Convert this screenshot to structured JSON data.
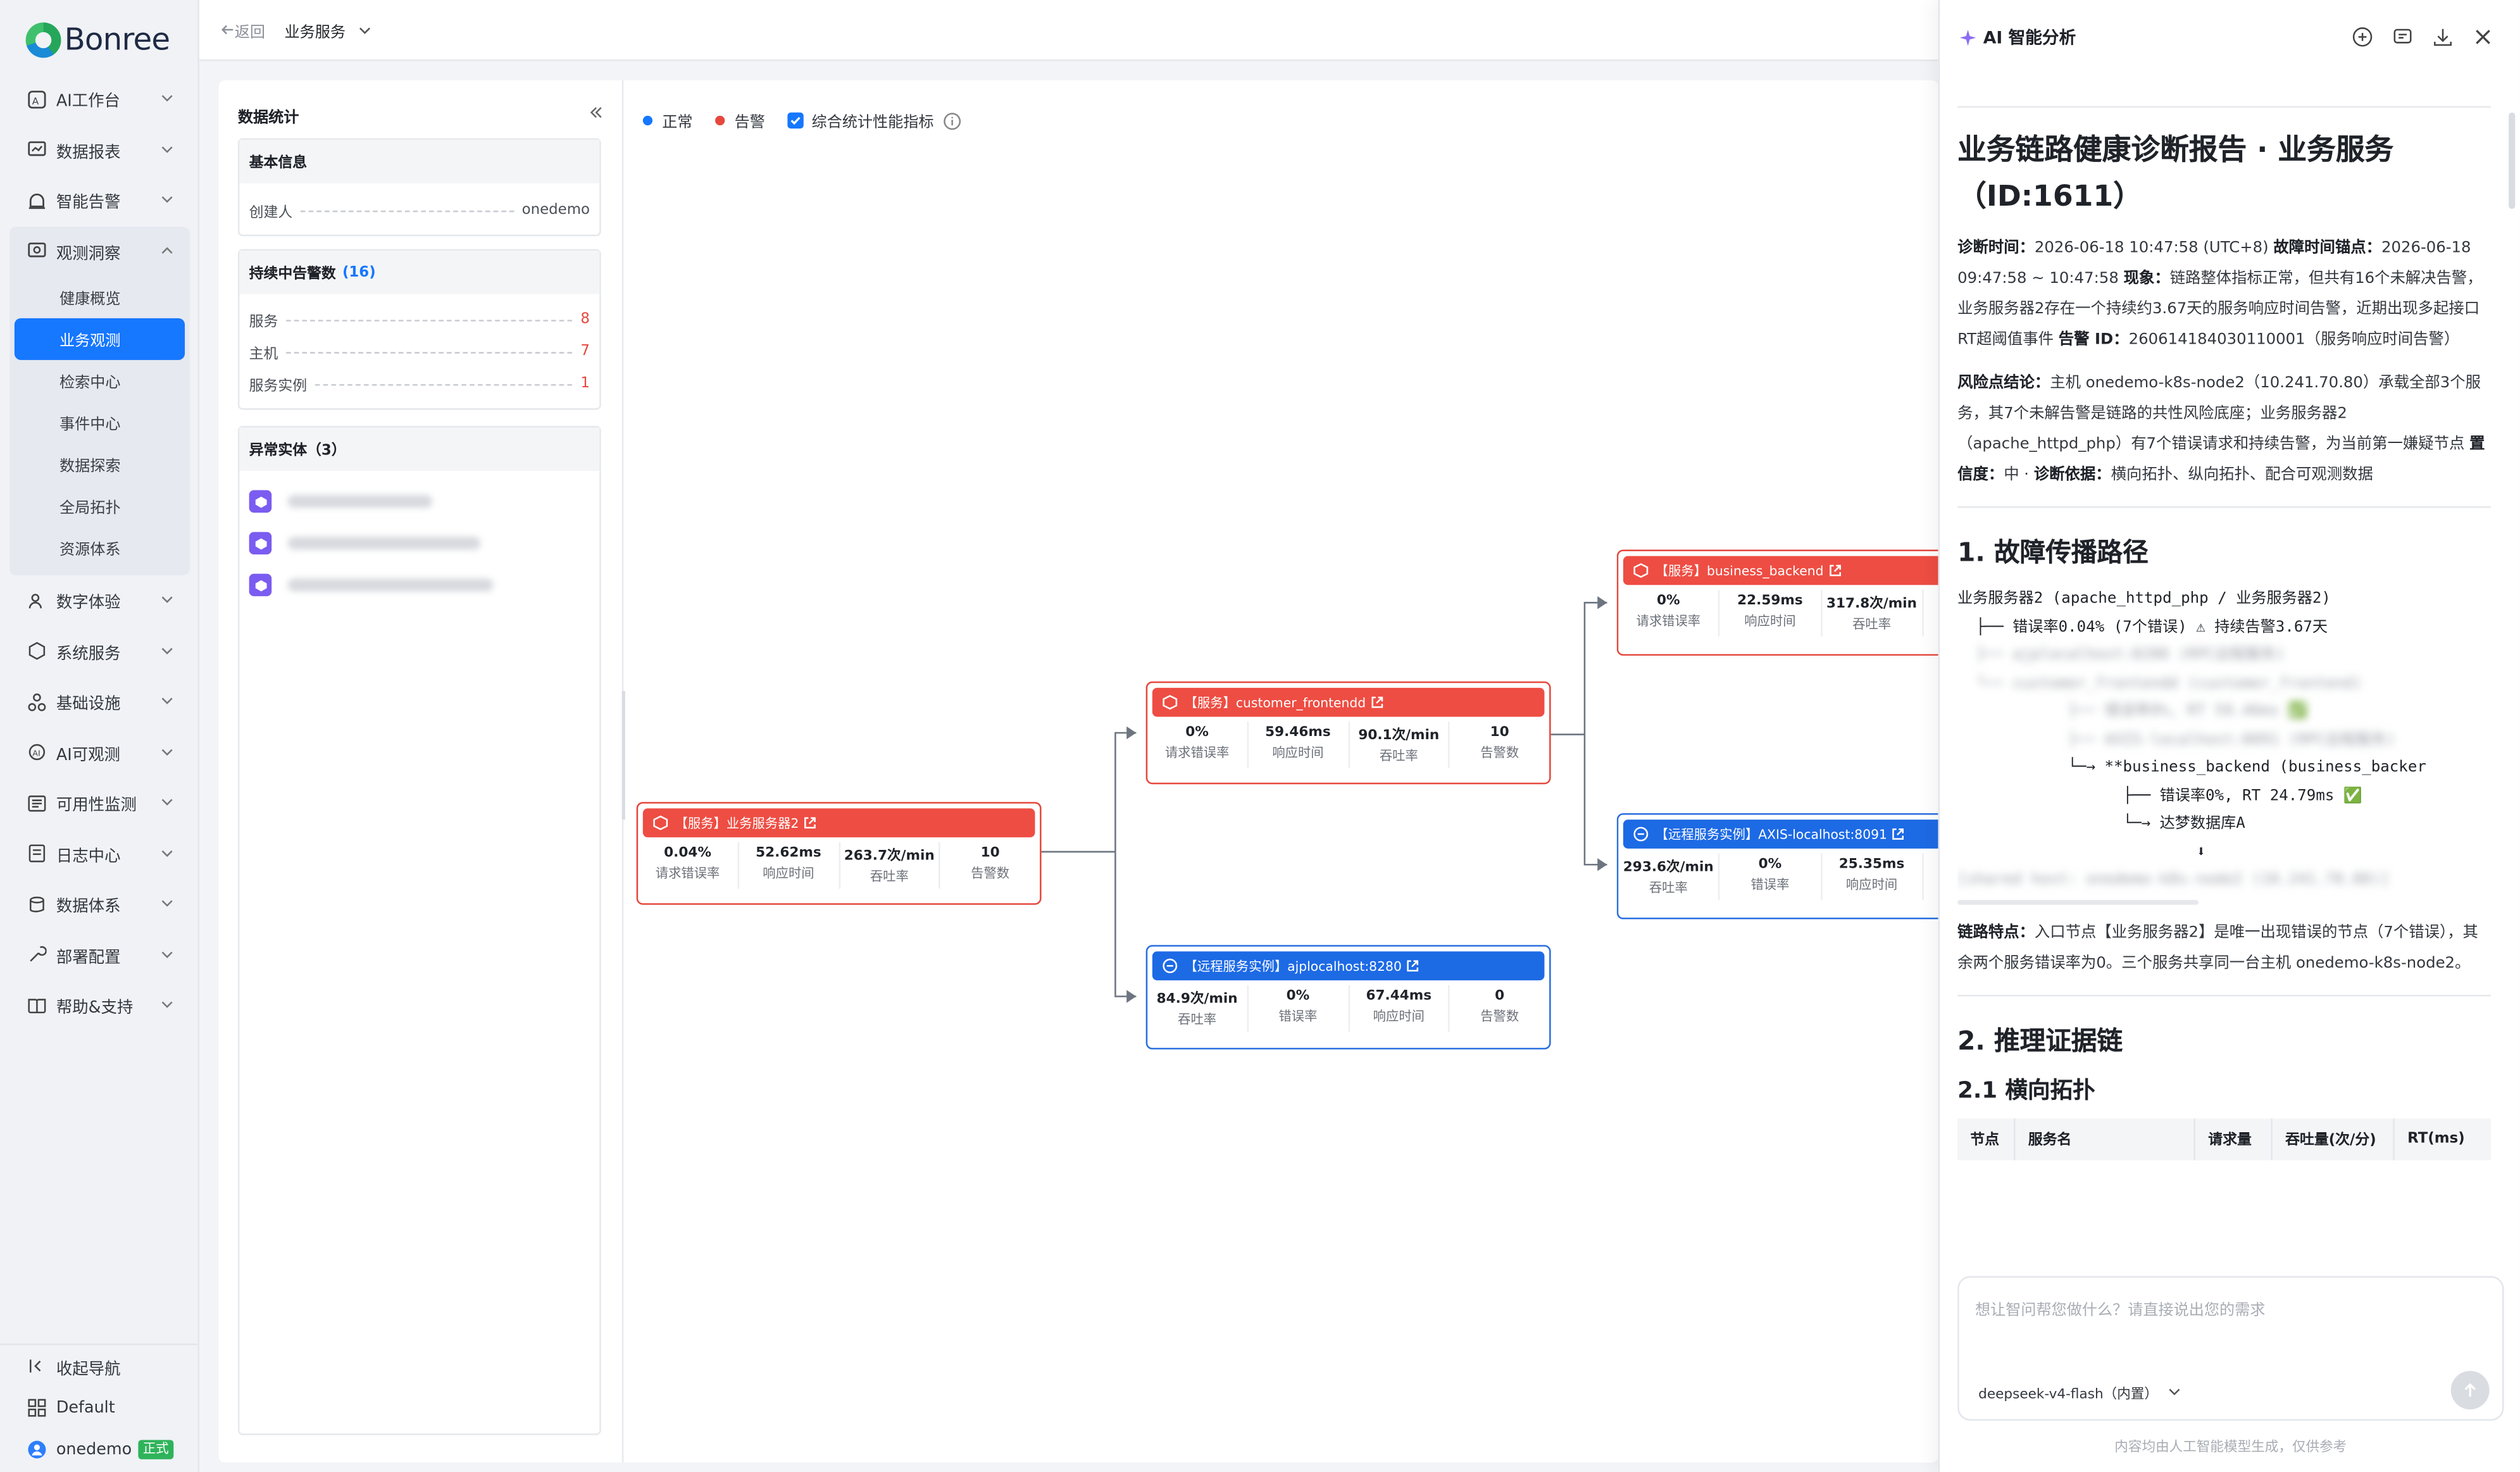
{
  "brand": "Bonree",
  "nav": [
    {
      "label": "AI工作台",
      "icon": "ai-workbench-icon"
    },
    {
      "label": "数据报表",
      "icon": "report-icon"
    },
    {
      "label": "智能告警",
      "icon": "alarm-icon"
    }
  ],
  "observe": {
    "label": "观测洞察",
    "subs": [
      "健康概览",
      "业务观测",
      "检索中心",
      "事件中心",
      "数据探索",
      "全局拓扑",
      "资源体系"
    ],
    "active": 1
  },
  "nav2": [
    {
      "label": "数字体验"
    },
    {
      "label": "系统服务"
    },
    {
      "label": "基础设施"
    },
    {
      "label": "AI可观测"
    },
    {
      "label": "可用性监测"
    },
    {
      "label": "日志中心"
    },
    {
      "label": "数据体系"
    },
    {
      "label": "部署配置"
    },
    {
      "label": "帮助&支持"
    }
  ],
  "footer": {
    "collapse": "收起导航",
    "space": "Default",
    "user": "onedemo",
    "user_tag": "正式"
  },
  "topbar": {
    "back": "返回",
    "title": "业务服务"
  },
  "stats": {
    "title": "数据统计",
    "basic": {
      "title": "基本信息",
      "creator_label": "创建人",
      "creator": "onedemo"
    },
    "alerts": {
      "title": "持续中告警数",
      "count": "(16)",
      "rows": [
        {
          "label": "服务",
          "value": "8"
        },
        {
          "label": "主机",
          "value": "7"
        },
        {
          "label": "服务实例",
          "value": "1"
        }
      ]
    },
    "abnormal": {
      "title": "异常实体（3）"
    }
  },
  "legend": {
    "normal": "正常",
    "alert": "告警",
    "combine": "综合统计性能指标",
    "normal_color": "#1677ff",
    "alert_color": "#e5483d"
  },
  "nodes": {
    "n1": {
      "title": "【服务】业务服务器2",
      "m": [
        [
          "0.04%",
          "请求错误率"
        ],
        [
          "52.62ms",
          "响应时间"
        ],
        [
          "263.7次/min",
          "吞吐率"
        ],
        [
          "10",
          "告警数"
        ]
      ]
    },
    "n2": {
      "title": "【服务】customer_frontendd",
      "m": [
        [
          "0%",
          "请求错误率"
        ],
        [
          "59.46ms",
          "响应时间"
        ],
        [
          "90.1次/min",
          "吞吐率"
        ],
        [
          "10",
          "告警数"
        ]
      ]
    },
    "n3": {
      "title": "【远程服务实例】ajplocalhost:8280",
      "m": [
        [
          "84.9次/min",
          "吞吐率"
        ],
        [
          "0%",
          "错误率"
        ],
        [
          "67.44ms",
          "响应时间"
        ],
        [
          "0",
          "告警数"
        ]
      ]
    },
    "n4": {
      "title": "【服务】business_backend",
      "m": [
        [
          "0%",
          "请求错误率"
        ],
        [
          "22.59ms",
          "响应时间"
        ],
        [
          "317.8次/min",
          "吞吐率"
        ]
      ]
    },
    "n5": {
      "title": "【远程服务实例】AXIS-localhost:8091",
      "m": [
        [
          "293.6次/min",
          "吞吐率"
        ],
        [
          "0%",
          "错误率"
        ],
        [
          "25.35ms",
          "响应时间"
        ]
      ]
    }
  },
  "ai": {
    "title": "AI 智能分析",
    "report_title": "业务链路健康诊断报告 · 业务服务（ID:1611）",
    "p1": {
      "l1": "诊断时间：",
      "v1": "2026-06-18 10:47:58 (UTC+8) ",
      "l2": "故障时间锚点：",
      "v2": "2026-06-18 09:47:58 ~ 10:47:58 ",
      "l3": "现象：",
      "v3": "链路整体指标正常，但共有16个未解决告警，业务服务器2存在一个持续约3.67天的服务响应时间告警，近期出现多起接口RT超阈值事件 ",
      "l4": "告警 ID：",
      "v4": "260614184030110001（服务响应时间告警）"
    },
    "p2": {
      "l1": "风险点结论：",
      "v1": "主机 onedemo-k8s-node2（10.241.70.80）承载全部3个服务，其7个未解告警是链路的共性风险底座；业务服务器2（apache_httpd_php）有7个错误请求和持续告警，为当前第一嫌疑节点 ",
      "l2": "置信度：",
      "v2": "中 · ",
      "l3": "诊断依据：",
      "v3": "横向拓扑、纵向拓扑、配合可观测数据"
    },
    "h_path": "1. 故障传播路径",
    "code": [
      "业务服务器2 (apache_httpd_php / 业务服务器2)",
      "  ├── 错误率0.04% (7个错误) ⚠ 持续告警3.67天",
      "",
      "",
      "",
      "",
      "            └─→ **business_backend (business_backer",
      "                  ├── 错误率0%, RT 24.79ms ✅",
      "                  └─→ 达梦数据库A",
      "                          ⬇"
    ],
    "p3": {
      "l1": "链路特点：",
      "v1": "入口节点【业务服务器2】是唯一出现错误的节点（7个错误），其余两个服务错误率为0。三个服务共享同一台主机 onedemo-k8s-node2。"
    },
    "h_chain": "2. 推理证据链",
    "h_lateral": "2.1 横向拓扑",
    "table_headers": [
      "节点",
      "服务名",
      "请求量",
      "吞吐量(次/分)",
      "RT(ms)"
    ],
    "input_placeholder": "想让智问帮您做什么？请直接说出您的需求",
    "model": "deepseek-v4-flash（内置）",
    "disclaimer": "内容均由人工智能模型生成，仅供参考"
  }
}
